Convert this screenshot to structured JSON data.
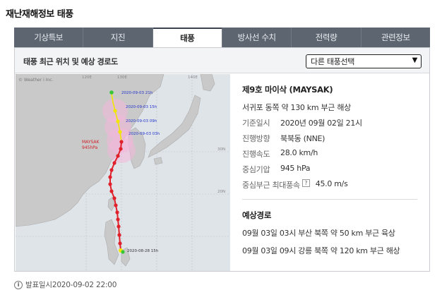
{
  "page": {
    "title": "재난재해정보 태풍"
  },
  "tabs": [
    {
      "label": "기상특보",
      "active": false
    },
    {
      "label": "지진",
      "active": false
    },
    {
      "label": "태풍",
      "active": true
    },
    {
      "label": "방사선 수치",
      "active": false
    },
    {
      "label": "전력량",
      "active": false
    },
    {
      "label": "관련정보",
      "active": false
    }
  ],
  "panel": {
    "title": "태풍 최근 위치 및 예상 경로도",
    "select_value": "다른 태풍선택"
  },
  "map": {
    "copyright": "© Weather i Inc.",
    "lon_labels": [
      "120E",
      "130E",
      "140E"
    ],
    "lat_labels": [
      "30N",
      "20N"
    ],
    "storm_label_1": "MAYSAK",
    "storm_label_2": "945hPa",
    "track_labels": [
      "2020-09-03 21h",
      "2020-09-03 15h",
      "2020-09-03 09h",
      "2020-09-03 03h",
      "2020-08-28 15h"
    ]
  },
  "info": {
    "name": "제9호 마이삭 (MAYSAK)",
    "location": "서귀포 동쪽 약 130 km 부근 해상",
    "rows": [
      {
        "label": "기준일시",
        "value": "2020년 09월 02일 21시"
      },
      {
        "label": "진행방향",
        "value": "북북동 (NNE)"
      },
      {
        "label": "진행속도",
        "value": "28.0 km/h"
      },
      {
        "label": "중심기압",
        "value": "945 hPa"
      },
      {
        "label": "중심부근 최대풍속",
        "value": "45.0 m/s"
      }
    ],
    "help_symbol": "?"
  },
  "forecast": {
    "title": "예상경로",
    "items": [
      "09월 03일 03시 부산 북쪽 약 50 km 부근 육상",
      "09월 03일 09시 강릉 북쪽 약 120 km 부근 해상"
    ]
  },
  "footer": {
    "issued": "발표일시2020-09-02 22:00",
    "icon": "i"
  },
  "colors": {
    "tab_bar": "#5d6670",
    "track_past": "#e0202a",
    "track_forecast": "#f2e600",
    "land": "#c9c9c9",
    "sea": "#dfe4e9",
    "radius": "#f3b6d8"
  }
}
